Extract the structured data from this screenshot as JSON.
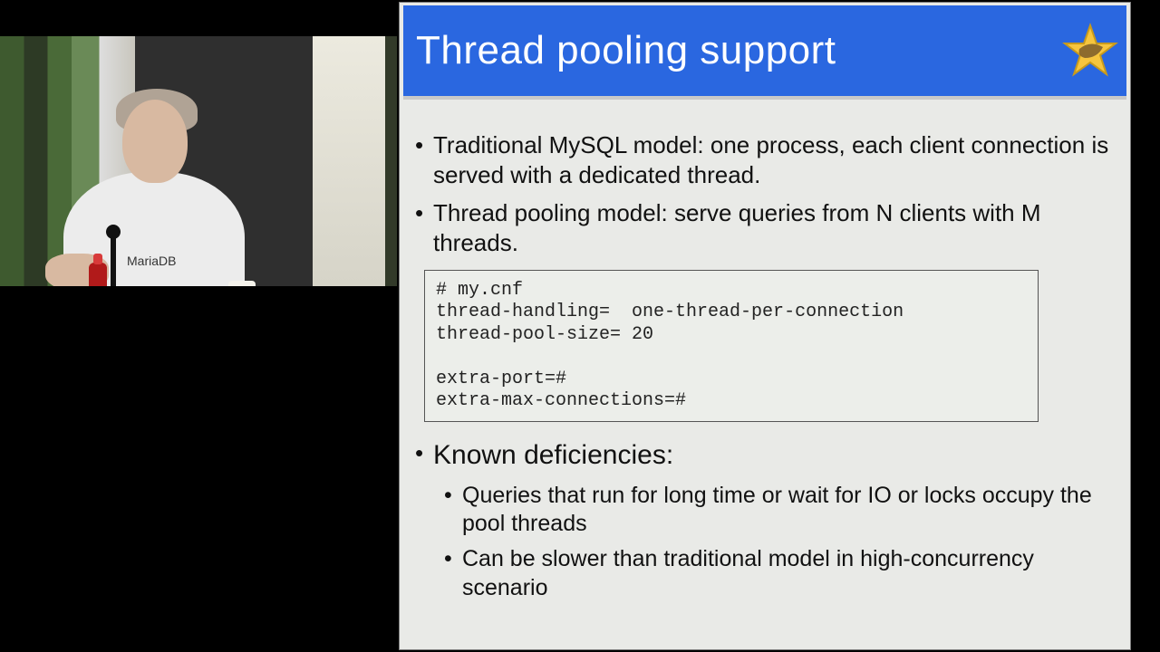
{
  "camera": {
    "shirt_text": "MariaDB"
  },
  "slide": {
    "title": "Thread pooling support",
    "bullets": {
      "b1": "Traditional MySQL model: one process, each client connection is served with a dedicated thread.",
      "b2": "Thread pooling model: serve queries from N clients with M threads.",
      "b3": "Known deficiencies:",
      "b3a": "Queries that run for long time or wait for IO or locks occupy the pool threads",
      "b3b": "Can be slower than traditional model in high-concurrency scenario"
    },
    "code": {
      "l1": "# my.cnf",
      "l2": "thread-handling=  one-thread-per-connection",
      "l3": "thread-pool-size= 20",
      "l4": "",
      "l5": "extra-port=#",
      "l6": "extra-max-connections=#"
    }
  }
}
